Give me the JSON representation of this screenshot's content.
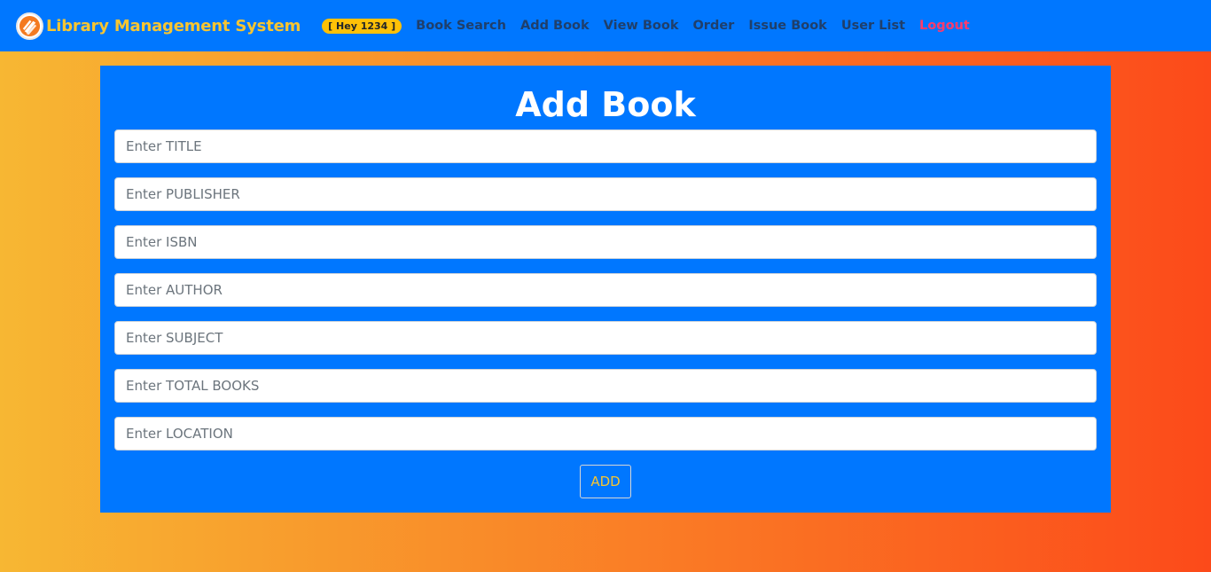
{
  "navbar": {
    "brand_title": "Library Management System",
    "logo_icon": "library-logo-icon",
    "greeting": "[ Hey 1234 ]",
    "links": [
      {
        "label": "Book Search"
      },
      {
        "label": "Add Book"
      },
      {
        "label": "View Book"
      },
      {
        "label": "Order"
      },
      {
        "label": "Issue Book"
      },
      {
        "label": "User List"
      },
      {
        "label": "Logout"
      }
    ]
  },
  "form": {
    "title": "Add Book",
    "fields": [
      {
        "placeholder": "Enter TITLE",
        "value": ""
      },
      {
        "placeholder": "Enter PUBLISHER",
        "value": ""
      },
      {
        "placeholder": "Enter ISBN",
        "value": ""
      },
      {
        "placeholder": "Enter AUTHOR",
        "value": ""
      },
      {
        "placeholder": "Enter SUBJECT",
        "value": ""
      },
      {
        "placeholder": "Enter TOTAL BOOKS",
        "value": ""
      },
      {
        "placeholder": "Enter LOCATION",
        "value": ""
      }
    ],
    "submit_label": "ADD"
  },
  "colors": {
    "navbar_bg": "#0077ff",
    "brand_text": "#f7c531",
    "nav_link": "#1f3f6b",
    "logout_link": "#ff3b6b",
    "card_bg": "#0077ff",
    "background_gradient_start": "#f7b733",
    "background_gradient_end": "#fc4a1a"
  }
}
